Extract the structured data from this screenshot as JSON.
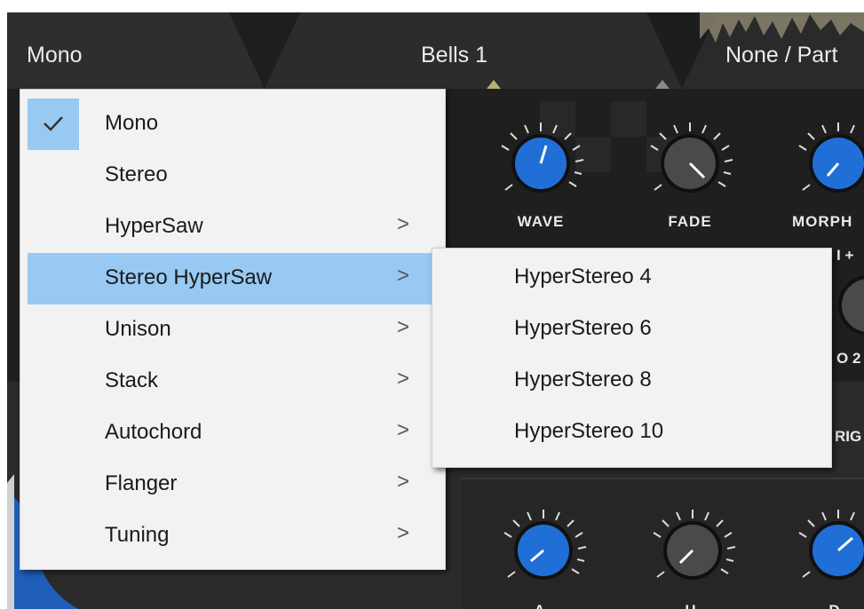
{
  "header": {
    "left_label": "Mono",
    "center_label": "Bells 1",
    "right_label": "None / Part"
  },
  "knobs": {
    "wave": "WAVE",
    "fade": "FADE",
    "morph": "MORPH",
    "a": "A",
    "h": "H",
    "d": "D"
  },
  "edge_labels": {
    "lfo": "I +",
    "o2": "O 2",
    "rig": "RIG"
  },
  "menu": {
    "items": [
      {
        "label": "Mono",
        "checked": true,
        "submenu": false
      },
      {
        "label": "Stereo",
        "checked": false,
        "submenu": false
      },
      {
        "label": "HyperSaw",
        "checked": false,
        "submenu": true
      },
      {
        "label": "Stereo HyperSaw",
        "checked": false,
        "submenu": true,
        "highlighted": true
      },
      {
        "label": "Unison",
        "checked": false,
        "submenu": true
      },
      {
        "label": "Stack",
        "checked": false,
        "submenu": true
      },
      {
        "label": "Autochord",
        "checked": false,
        "submenu": true
      },
      {
        "label": "Flanger",
        "checked": false,
        "submenu": true
      },
      {
        "label": "Tuning",
        "checked": false,
        "submenu": true
      }
    ],
    "chevron": ">",
    "check_icon": "checkmark-icon"
  },
  "submenu": {
    "items": [
      "HyperStereo 4",
      "HyperStereo 6",
      "HyperStereo 8",
      "HyperStereo 10"
    ]
  },
  "colors": {
    "knob_blue": "#1f6fd6",
    "knob_gray": "#4a4a4a",
    "highlight": "#98c9f3",
    "menu_bg": "#f2f2f2"
  }
}
